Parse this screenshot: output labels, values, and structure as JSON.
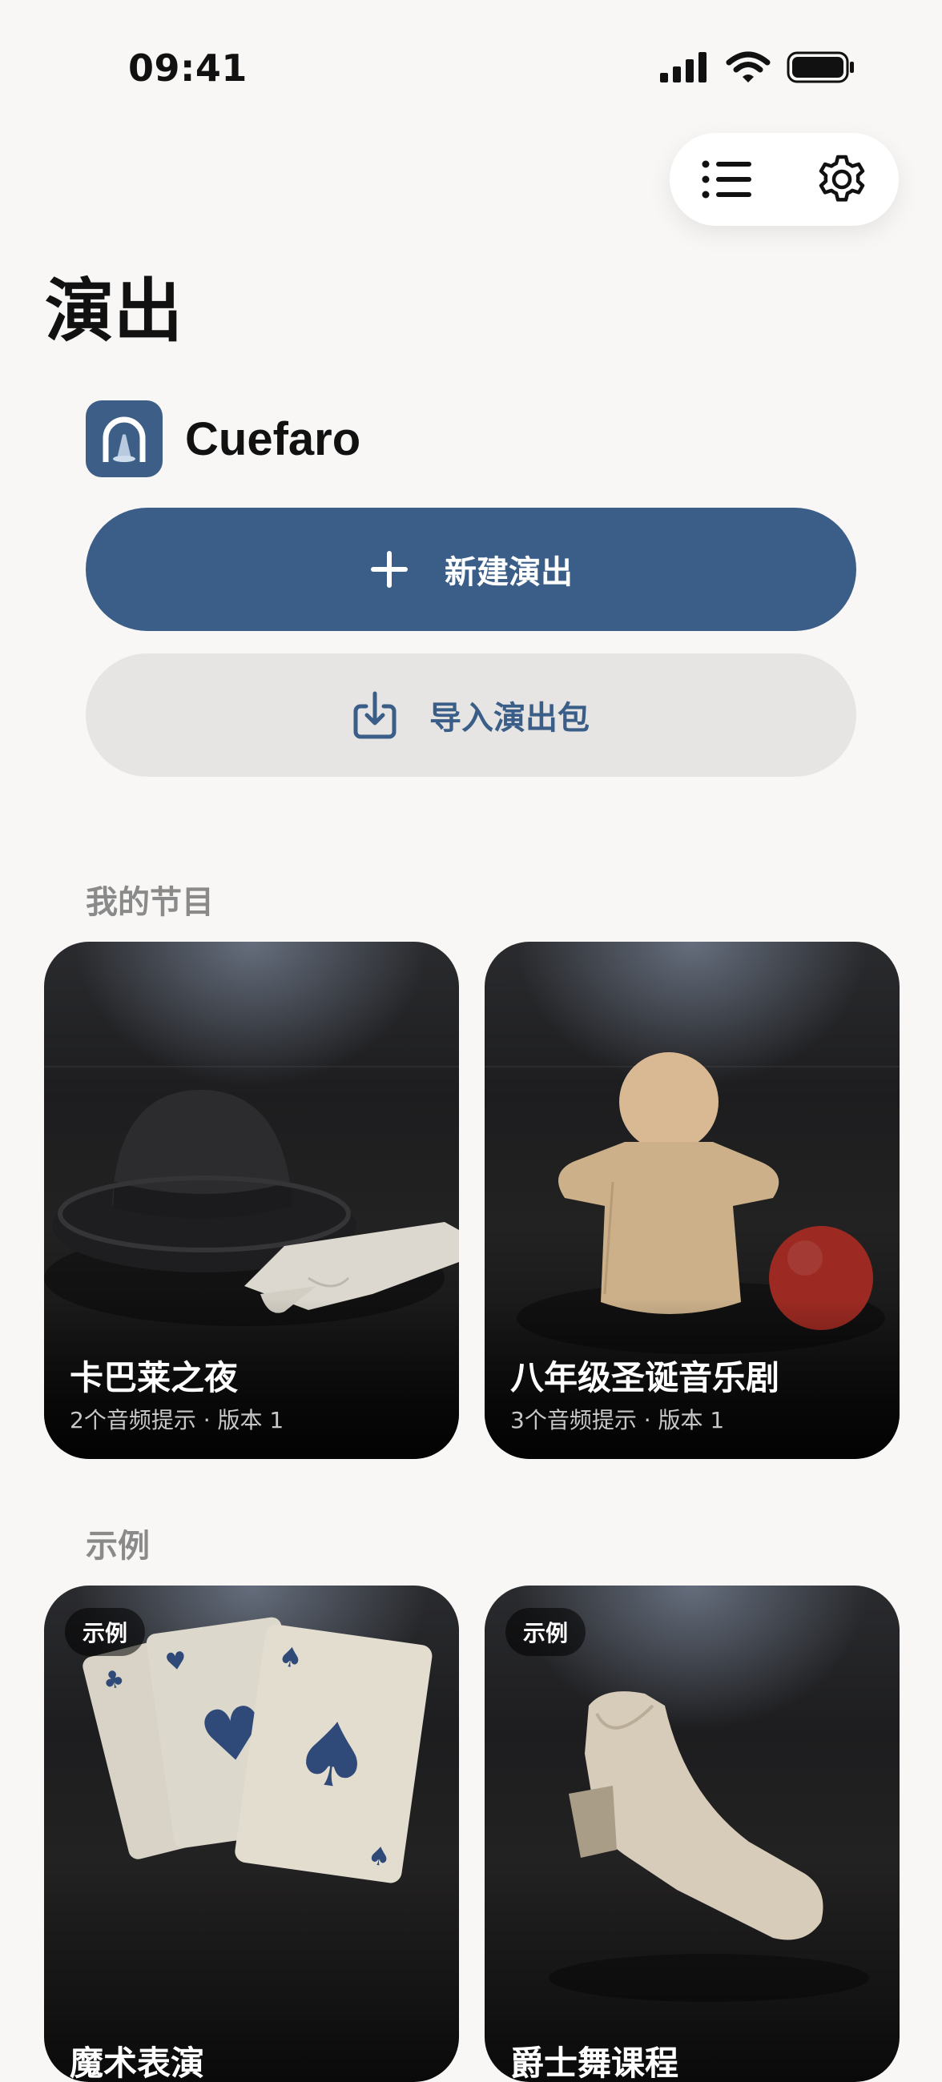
{
  "status_bar": {
    "time": "09:41"
  },
  "header": {
    "title": "演出"
  },
  "brand": {
    "name": "Cuefaro"
  },
  "actions": {
    "new_show_label": "新建演出",
    "import_label": "导入演出包"
  },
  "my_shows": {
    "title": "我的节目",
    "items": [
      {
        "title": "卡巴莱之夜",
        "subtitle": "2个音频提示 · 版本 1",
        "image": "bowler-hat-and-gloves"
      },
      {
        "title": "八年级圣诞音乐剧",
        "subtitle": "3个音频提示 · 版本 1",
        "image": "hand-puppet-and-red-ball"
      }
    ]
  },
  "examples": {
    "title": "示例",
    "items": [
      {
        "badge": "示例",
        "title": "魔术表演",
        "image": "playing-cards"
      },
      {
        "badge": "示例",
        "title": "爵士舞课程",
        "image": "jazz-shoe"
      }
    ]
  },
  "colors": {
    "accent": "#3a5e88",
    "background": "#f8f7f5",
    "secondary_button": "#e6e5e3"
  }
}
